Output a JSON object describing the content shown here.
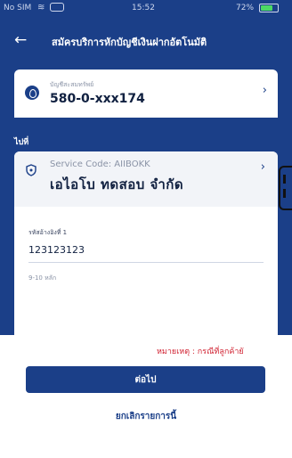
{
  "status_bar": {
    "carrier": "No SIM",
    "time": "15:52",
    "battery": "72%",
    "battery_level": 0.72
  },
  "header": {
    "title": "สมัครบริการหักบัญชีเงินฝากอัตโนมัติ"
  },
  "account": {
    "label": "บัญชีสะสมทรัพย์",
    "value": "580-0-xxx174"
  },
  "to_section": {
    "label": "ไปที่"
  },
  "service": {
    "code": "Service Code: AIIBOKK",
    "company": "เอไอโบ ทดสอบ จำกัด"
  },
  "reference": {
    "label": "รหัสอ้างอิงที่ 1",
    "value": "123123123",
    "hint": "9-10 หลัก"
  },
  "note": "หมายเหตุ : กรณีที่ลูกค้ายั",
  "buttons": {
    "next": "ต่อไป",
    "cancel": "ยกเลิกรายการนี้"
  },
  "colors": {
    "primary": "#1b3f88",
    "note": "#d01f2f"
  }
}
